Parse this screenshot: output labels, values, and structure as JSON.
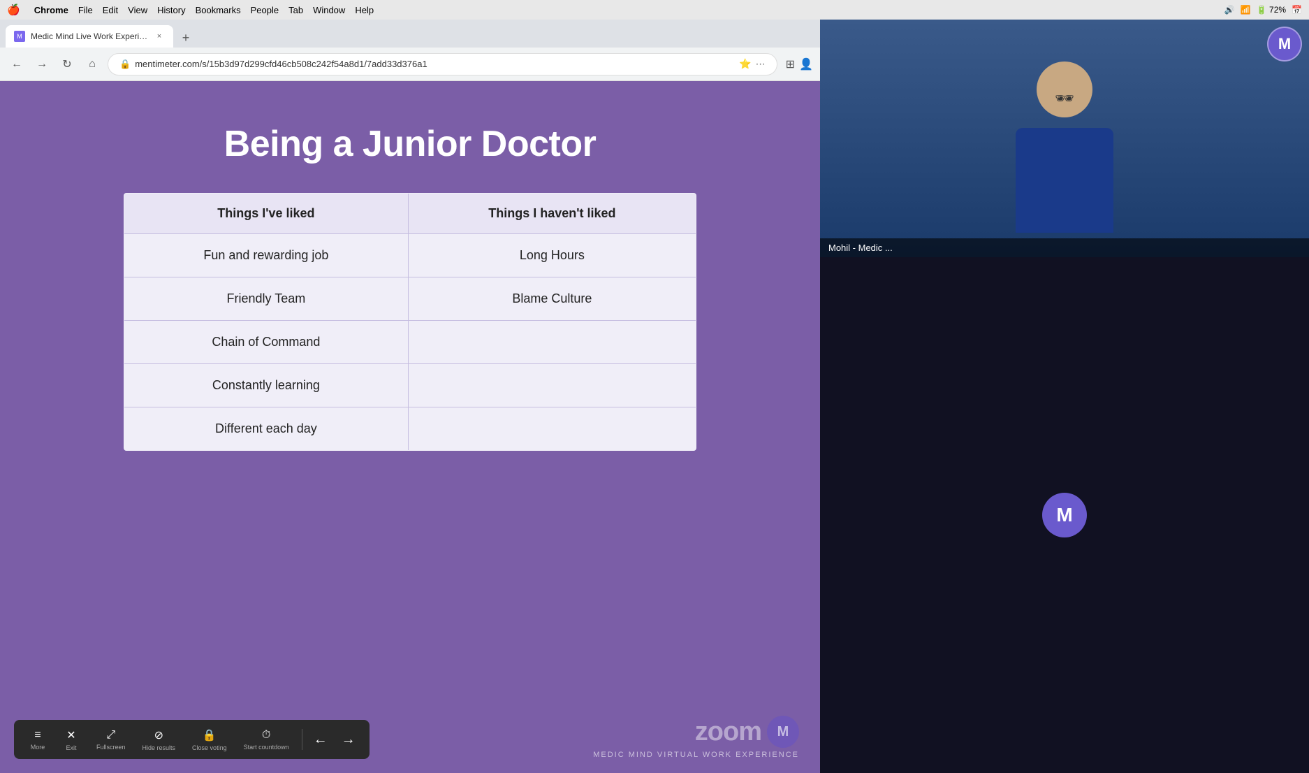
{
  "os": {
    "menubar": {
      "apple": "🍎",
      "items": [
        "Chrome",
        "File",
        "Edit",
        "View",
        "History",
        "Bookmarks",
        "People",
        "Tab",
        "Window",
        "Help"
      ],
      "bold_item": "Chrome"
    }
  },
  "browser": {
    "tab": {
      "title": "Medic Mind Live Work Experie…",
      "favicon_letter": "M",
      "close_label": "×"
    },
    "new_tab_label": "+",
    "address": "mentimeter.com/s/15b3d97d299cfd46cb508c242f54a8d1/7add33d376a1"
  },
  "toolbar": {
    "back_icon": "←",
    "forward_icon": "→",
    "reload_icon": "↻",
    "home_icon": "⌂"
  },
  "presentation": {
    "title": "Being a Junior Doctor",
    "table": {
      "col1_header": "Things I've liked",
      "col2_header": "Things I haven't liked",
      "rows": [
        {
          "liked": "Fun and rewarding job",
          "not_liked": "Long Hours"
        },
        {
          "liked": "Friendly Team",
          "not_liked": "Blame Culture"
        },
        {
          "liked": "Chain of Command",
          "not_liked": ""
        },
        {
          "liked": "Constantly learning",
          "not_liked": ""
        },
        {
          "liked": "Different each day",
          "not_liked": ""
        }
      ]
    }
  },
  "bottom_toolbar": {
    "buttons": [
      {
        "icon": "≡",
        "label": "More"
      },
      {
        "icon": "✕",
        "label": "Exit"
      },
      {
        "icon": "⤢",
        "label": "Fullscreen"
      },
      {
        "icon": "⊘",
        "label": "Hide results"
      },
      {
        "icon": "🔒",
        "label": "Close voting"
      },
      {
        "icon": "⏱",
        "label": "Start countdown"
      }
    ],
    "prev_arrow": "←",
    "next_arrow": "→"
  },
  "watermark": {
    "zoom_logo": "zoom",
    "medic_text": "MEDIC MIND VIRTUAL WORK EXPERIENCE"
  },
  "zoom": {
    "participant_name": "Mohil - Medic ...",
    "avatar_letter": "M",
    "self_avatar_letter": "M"
  }
}
